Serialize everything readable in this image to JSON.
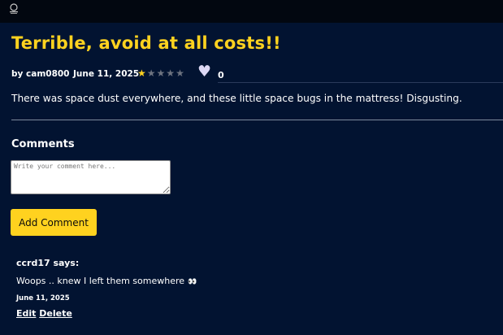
{
  "colors": {
    "background": "#021331",
    "topbar": "#020710",
    "accent": "#ffd21f",
    "heart": "#ddd8f4"
  },
  "header": {
    "logo_icon": "site-logo-icon"
  },
  "review": {
    "title": "Terrible, avoid at all costs!!",
    "author": "by cam0800",
    "date": "June 11, 2025",
    "rating": 1,
    "max_rating": 5,
    "like_icon": "heart-icon",
    "like_count": "0",
    "body": "There was space dust everywhere, and these little space bugs in the mattress! Disgusting."
  },
  "comments": {
    "heading": "Comments",
    "input_placeholder": "Write your comment here...",
    "input_value": "",
    "submit_label": "Add Comment",
    "items": [
      {
        "author": "ccrd17 says:",
        "text": "Woops .. knew I left them somewhere",
        "emoji": "👀",
        "date": "June 11, 2025",
        "edit_label": "Edit",
        "delete_label": "Delete"
      }
    ]
  }
}
